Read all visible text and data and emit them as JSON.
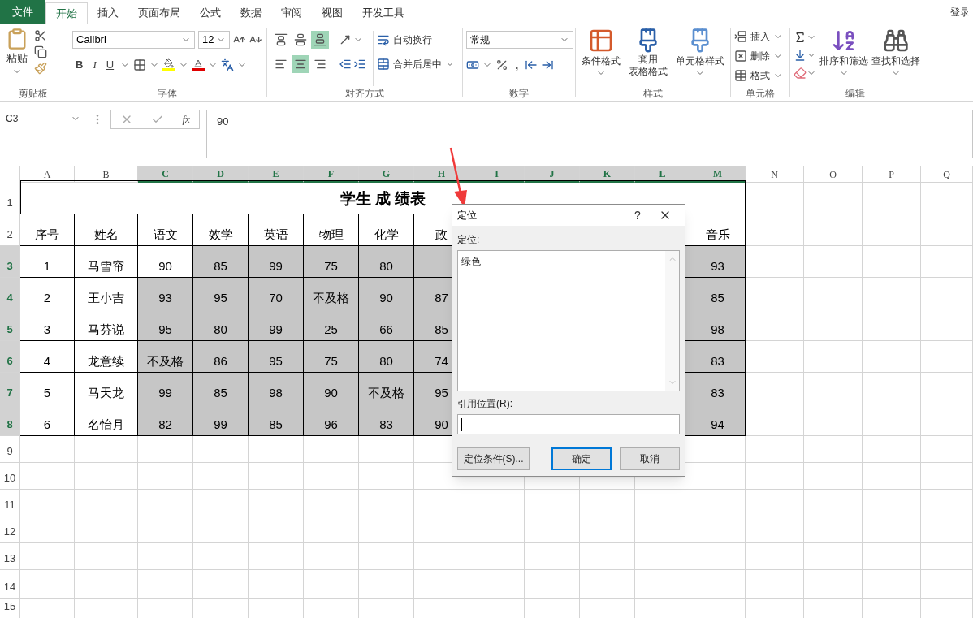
{
  "ribbon_tabs": [
    {
      "label": "文件",
      "kind": "file",
      "selected": false
    },
    {
      "label": "开始",
      "kind": "tab",
      "selected": true
    },
    {
      "label": "插入",
      "kind": "tab",
      "selected": false
    },
    {
      "label": "页面布局",
      "kind": "tab",
      "selected": false
    },
    {
      "label": "公式",
      "kind": "tab",
      "selected": false
    },
    {
      "label": "数据",
      "kind": "tab",
      "selected": false
    },
    {
      "label": "审阅",
      "kind": "tab",
      "selected": false
    },
    {
      "label": "视图",
      "kind": "tab",
      "selected": false
    },
    {
      "label": "开发工具",
      "kind": "tab",
      "selected": false
    }
  ],
  "account": "登录",
  "clipboard": {
    "paste": "粘贴",
    "label": "剪贴板"
  },
  "font": {
    "name": "Calibri",
    "size": "12",
    "bold": "B",
    "italic": "I",
    "underline": "U",
    "label": "字体"
  },
  "alignment": {
    "vertical": [
      {
        "selected": false
      },
      {
        "selected": false
      },
      {
        "selected": true
      }
    ],
    "horizontal": [
      {
        "selected": false
      },
      {
        "selected": true
      },
      {
        "selected": false
      }
    ],
    "wrap_text": "自动换行",
    "merge": "合并后居中",
    "label": "对齐方式"
  },
  "number": {
    "format": "常规",
    "comma": ",",
    "label": "数字"
  },
  "styles": {
    "conditional": "条件格式",
    "table_format": [
      "套用",
      "表格格式"
    ],
    "cell_styles": "单元格样式",
    "label": "样式"
  },
  "cells": {
    "insert": "插入",
    "delete": "删除",
    "format": "格式",
    "label": "单元格"
  },
  "editing": {
    "sort": "排序和筛选",
    "find": "查找和选择",
    "label": "编辑"
  },
  "formula_bar": {
    "name_box": "C3",
    "fx": "fx",
    "value": "90"
  },
  "sheet": {
    "columns": [
      {
        "label": "A",
        "selected": false
      },
      {
        "label": "B",
        "selected": false
      },
      {
        "label": "C",
        "selected": true
      },
      {
        "label": "D",
        "selected": true
      },
      {
        "label": "E",
        "selected": true
      },
      {
        "label": "F",
        "selected": true
      },
      {
        "label": "G",
        "selected": true
      },
      {
        "label": "H",
        "selected": true
      },
      {
        "label": "I",
        "selected": true
      },
      {
        "label": "J",
        "selected": true
      },
      {
        "label": "K",
        "selected": true
      },
      {
        "label": "L",
        "selected": true
      },
      {
        "label": "M",
        "selected": true
      },
      {
        "label": "N",
        "selected": false
      },
      {
        "label": "O",
        "selected": false
      },
      {
        "label": "P",
        "selected": false
      },
      {
        "label": "Q",
        "selected": false
      }
    ],
    "rows": [
      {
        "label": "1",
        "selected": false,
        "title": "学生 成 绩表"
      },
      {
        "label": "2",
        "selected": false,
        "cells": [
          {
            "text": "序号",
            "selected": false
          },
          {
            "text": "姓名",
            "selected": false
          },
          {
            "text": "语文",
            "selected": false
          },
          {
            "text": "效学",
            "selected": false
          },
          {
            "text": "英语",
            "selected": false
          },
          {
            "text": "物理",
            "selected": false
          },
          {
            "text": "化学",
            "selected": false
          },
          {
            "text": "政",
            "selected": false
          },
          null,
          null,
          null,
          null,
          {
            "text": "音乐",
            "selected": false
          }
        ]
      },
      {
        "label": "3",
        "selected": true,
        "cells": [
          {
            "text": "1",
            "selected": false
          },
          {
            "text": "马雪帘",
            "selected": false
          },
          {
            "text": "90",
            "selected": false
          },
          {
            "text": "85",
            "selected": true
          },
          {
            "text": "99",
            "selected": true
          },
          {
            "text": "75",
            "selected": true
          },
          {
            "text": "80",
            "selected": true
          },
          null,
          null,
          null,
          null,
          null,
          {
            "text": "93",
            "selected": true
          }
        ]
      },
      {
        "label": "4",
        "selected": true,
        "cells": [
          {
            "text": "2",
            "selected": false
          },
          {
            "text": "王小吉",
            "selected": false
          },
          {
            "text": "93",
            "selected": true
          },
          {
            "text": "95",
            "selected": true
          },
          {
            "text": "70",
            "selected": true
          },
          {
            "text": "不及格",
            "selected": true
          },
          {
            "text": "90",
            "selected": true
          },
          {
            "text": "87",
            "selected": true
          },
          null,
          null,
          null,
          null,
          {
            "text": "85",
            "selected": true
          }
        ]
      },
      {
        "label": "5",
        "selected": true,
        "cells": [
          {
            "text": "3",
            "selected": false
          },
          {
            "text": "马芬说",
            "selected": false
          },
          {
            "text": "95",
            "selected": true
          },
          {
            "text": "80",
            "selected": true
          },
          {
            "text": "99",
            "selected": true
          },
          {
            "text": "25",
            "selected": true
          },
          {
            "text": "66",
            "selected": true
          },
          {
            "text": "85",
            "selected": true
          },
          null,
          null,
          null,
          null,
          {
            "text": "98",
            "selected": true
          }
        ]
      },
      {
        "label": "6",
        "selected": true,
        "cells": [
          {
            "text": "4",
            "selected": false
          },
          {
            "text": "龙意续",
            "selected": false
          },
          {
            "text": "不及格",
            "selected": true
          },
          {
            "text": "86",
            "selected": true
          },
          {
            "text": "95",
            "selected": true
          },
          {
            "text": "75",
            "selected": true
          },
          {
            "text": "80",
            "selected": true
          },
          {
            "text": "74",
            "selected": true
          },
          null,
          null,
          null,
          null,
          {
            "text": "83",
            "selected": true
          }
        ]
      },
      {
        "label": "7",
        "selected": true,
        "cells": [
          {
            "text": "5",
            "selected": false
          },
          {
            "text": "马天龙",
            "selected": false
          },
          {
            "text": "99",
            "selected": true
          },
          {
            "text": "85",
            "selected": true
          },
          {
            "text": "98",
            "selected": true
          },
          {
            "text": "90",
            "selected": true
          },
          {
            "text": "不及格",
            "selected": true
          },
          {
            "text": "95",
            "selected": true
          },
          null,
          null,
          null,
          null,
          {
            "text": "83",
            "selected": true
          }
        ]
      },
      {
        "label": "8",
        "selected": true,
        "cells": [
          {
            "text": "6",
            "selected": false
          },
          {
            "text": "名怡月",
            "selected": false
          },
          {
            "text": "82",
            "selected": true
          },
          {
            "text": "99",
            "selected": true
          },
          {
            "text": "85",
            "selected": true
          },
          {
            "text": "96",
            "selected": true
          },
          {
            "text": "83",
            "selected": true
          },
          {
            "text": "90",
            "selected": true
          },
          null,
          null,
          null,
          null,
          {
            "text": "94",
            "selected": true
          }
        ]
      },
      {
        "label": "9",
        "selected": false
      },
      {
        "label": "10",
        "selected": false
      },
      {
        "label": "11",
        "selected": false
      },
      {
        "label": "12",
        "selected": false
      },
      {
        "label": "13",
        "selected": false
      },
      {
        "label": "14",
        "selected": false
      },
      {
        "label": "15",
        "selected": false
      }
    ]
  },
  "dialog": {
    "title": "定位",
    "help": "?",
    "list_label": "定位:",
    "list_items": [
      "绿色"
    ],
    "reference_label": "引用位置(R):",
    "special_button": "定位条件(S)...",
    "ok_button": "确定",
    "cancel_button": "取消"
  }
}
